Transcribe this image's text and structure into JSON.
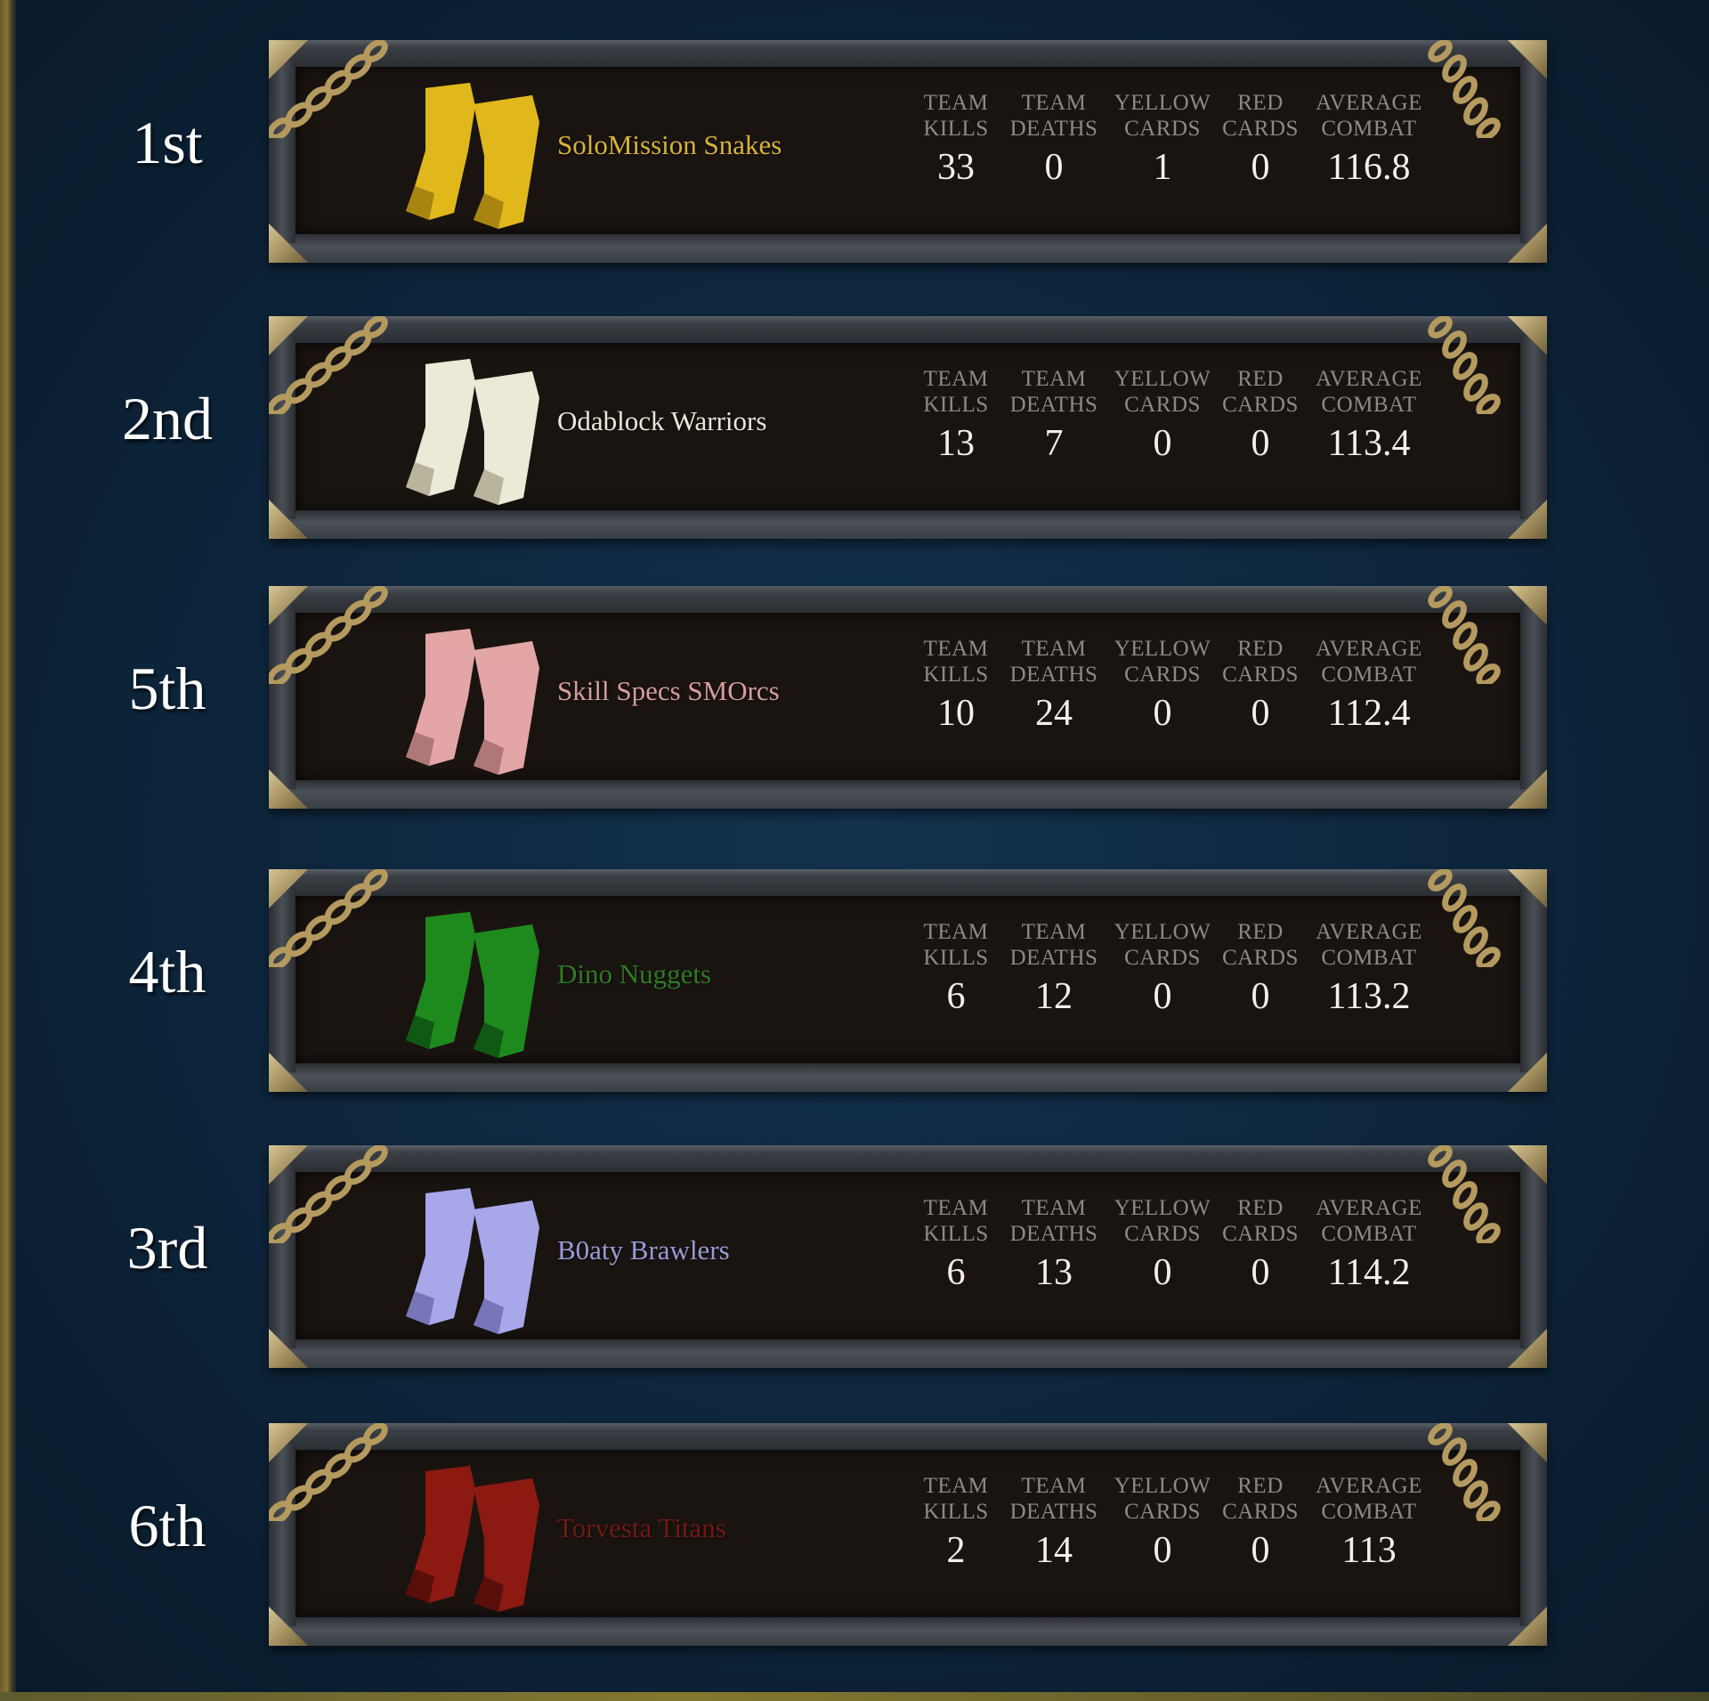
{
  "columns": [
    {
      "key": "kills",
      "label": "TEAM\nKILLS"
    },
    {
      "key": "deaths",
      "label": "TEAM\nDEATHS"
    },
    {
      "key": "yellow",
      "label": "YELLOW\nCARDS"
    },
    {
      "key": "red",
      "label": "RED\nCARDS"
    },
    {
      "key": "combat",
      "label": "AVERAGE\nCOMBAT"
    }
  ],
  "teams": [
    {
      "rank": "1st",
      "name": "SoloMission Snakes",
      "color": "#d6b43a",
      "boot_color": "#e0b81c",
      "boot_shade": "#a88510",
      "boots_icon": "yellow-boots-icon",
      "kills": "33",
      "deaths": "0",
      "yellow": "1",
      "red": "0",
      "combat": "116.8"
    },
    {
      "rank": "2nd",
      "name": "Odablock Warriors",
      "color": "#ebe6da",
      "boot_color": "#ece9d6",
      "boot_shade": "#b9b59c",
      "boots_icon": "white-boots-icon",
      "kills": "13",
      "deaths": "7",
      "yellow": "0",
      "red": "0",
      "combat": "113.4"
    },
    {
      "rank": "5th",
      "name": "Skill Specs SMOrcs",
      "color": "#d79d9d",
      "boot_color": "#e3a5a5",
      "boot_shade": "#b07777",
      "boots_icon": "pink-boots-icon",
      "kills": "10",
      "deaths": "24",
      "yellow": "0",
      "red": "0",
      "combat": "112.4"
    },
    {
      "rank": "4th",
      "name": "Dino Nuggets",
      "color": "#2f7a24",
      "boot_color": "#1e8a1e",
      "boot_shade": "#0f5a12",
      "boots_icon": "green-boots-icon",
      "kills": "6",
      "deaths": "12",
      "yellow": "0",
      "red": "0",
      "combat": "113.2"
    },
    {
      "rank": "3rd",
      "name": "B0aty Brawlers",
      "color": "#9a9ad6",
      "boot_color": "#a7a7ea",
      "boot_shade": "#7676b8",
      "boots_icon": "lilac-boots-icon",
      "kills": "6",
      "deaths": "13",
      "yellow": "0",
      "red": "0",
      "combat": "114.2"
    },
    {
      "rank": "6th",
      "name": "Torvesta Titans",
      "color": "#6e1a14",
      "boot_color": "#8c1a12",
      "boot_shade": "#5a0e0a",
      "boots_icon": "red-boots-icon",
      "kills": "2",
      "deaths": "14",
      "yellow": "0",
      "red": "0",
      "combat": "113"
    }
  ]
}
